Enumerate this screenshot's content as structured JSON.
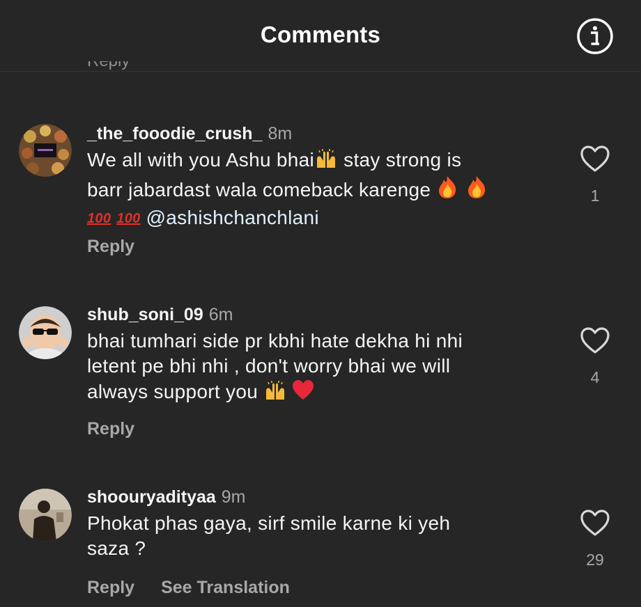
{
  "header": {
    "title": "Comments",
    "info_icon": "info-circle-icon"
  },
  "comments": [
    {
      "username": "_the_fooodie_crush_",
      "time": "8m",
      "text_line1": "We all with you Ashu bhai",
      "text_line1b": " stay strong is",
      "text_line2": "barr jabardast wala comeback karenge ",
      "hundred": "100",
      "mention": "@ashishchanchlani",
      "likes": "1",
      "reply_label": "Reply",
      "emojis": [
        "raising-hands-icon",
        "fire-icon",
        "fire-icon",
        "hundred-points-icon",
        "hundred-points-icon"
      ]
    },
    {
      "username": "shub_soni_09",
      "time": "6m",
      "text_line1": "bhai tumhari side pr kbhi hate dekha hi nhi",
      "text_line2": "letent pe bhi nhi , don't worry bhai we will",
      "text_line3": "always support you ",
      "likes": "4",
      "reply_label": "Reply",
      "emojis": [
        "raising-hands-icon",
        "red-heart-icon"
      ]
    },
    {
      "username": "shoouryadityaa",
      "time": "9m",
      "text_line1": "Phokat phas gaya, sirf smile karne ki yeh",
      "text_line2": "saza ?",
      "likes": "29",
      "reply_label": "Reply",
      "translate_label": "See Translation"
    }
  ],
  "colors": {
    "background": "#262626",
    "text_primary": "#f5f5f5",
    "text_secondary": "#a8a8a8",
    "mention": "#e0f1ff",
    "fire": "#ff7a1a",
    "heart": "#e8283a"
  }
}
